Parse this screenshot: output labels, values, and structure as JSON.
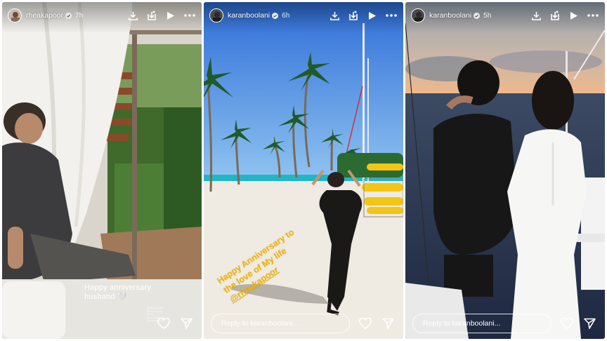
{
  "stories": [
    {
      "username": "rheakapoor",
      "timestamp": "7h",
      "caption": "Happy anniversary\nhusband 🤍",
      "tag_text": "@karanboolani\n@rheakapoor\n#anniv\n@karanboolani\n@rheakapoor"
    },
    {
      "username": "karanboolani",
      "timestamp": "6h",
      "caption_line1": "Happy Anniversary to",
      "caption_line2": "the love of My life",
      "caption_mention": "@rheakapoor",
      "reply_placeholder": "Reply to karanboolani..."
    },
    {
      "username": "karanboolani",
      "timestamp": "5h",
      "reply_placeholder": "Reply to karanboolani..."
    }
  ],
  "icons": {
    "verified": "verified-badge-icon",
    "download": "download-icon",
    "add_to_story": "add-to-story-icon",
    "play": "play-icon",
    "more": "more-options-icon",
    "like": "heart-icon",
    "share": "send-icon"
  },
  "colors": {
    "verified": "#3897f0",
    "caption_yellow": "#f5b400",
    "white": "#ffffff"
  }
}
